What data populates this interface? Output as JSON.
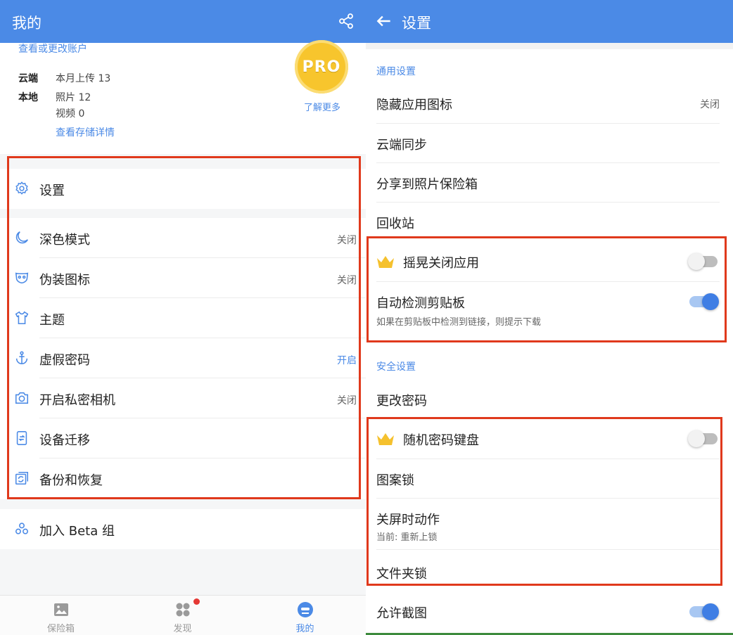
{
  "left": {
    "title": "我的",
    "account_link": "查看或更改账户",
    "cloud_label": "云端",
    "cloud_value": "本月上传 13",
    "local_label": "本地",
    "photos_value": "照片 12",
    "videos_value": "视频 0",
    "storage_link": "查看存储详情",
    "pro_badge": "PRO",
    "learn_more": "了解更多",
    "settings_label": "设置",
    "menu_items": [
      {
        "label": "深色模式",
        "status": "关闭",
        "icon": "moon-icon"
      },
      {
        "label": "伪装图标",
        "status": "关闭",
        "icon": "mask-icon"
      },
      {
        "label": "主题",
        "status": "",
        "icon": "shirt-icon"
      },
      {
        "label": "虚假密码",
        "status": "开启",
        "icon": "anchor-icon"
      },
      {
        "label": "开启私密相机",
        "status": "关闭",
        "icon": "camera-icon"
      },
      {
        "label": "设备迁移",
        "status": "",
        "icon": "phone-transfer-icon"
      },
      {
        "label": "备份和恢复",
        "status": "",
        "icon": "backup-icon"
      }
    ],
    "beta_label": "加入 Beta 组",
    "nav": [
      {
        "label": "保险箱",
        "icon": "gallery-icon"
      },
      {
        "label": "发现",
        "icon": "discover-icon"
      },
      {
        "label": "我的",
        "icon": "profile-icon"
      }
    ]
  },
  "right": {
    "title": "设置",
    "general_section": "通用设置",
    "general_items": [
      {
        "label": "隐藏应用图标",
        "status": "关闭"
      },
      {
        "label": "云端同步",
        "status": ""
      },
      {
        "label": "分享到照片保险箱",
        "status": ""
      },
      {
        "label": "回收站",
        "status": ""
      }
    ],
    "shake_close": {
      "label": "摇晃关闭应用",
      "enabled": false
    },
    "clipboard": {
      "label": "自动检测剪贴板",
      "description": "如果在剪贴板中检测到链接，则提示下载",
      "enabled": true
    },
    "security_section": "安全设置",
    "change_password": "更改密码",
    "random_keyboard": {
      "label": "随机密码键盘",
      "enabled": false
    },
    "pattern_lock": "图案锁",
    "screen_off_action": {
      "label": "关屏时动作",
      "current": "当前: 重新上锁"
    },
    "folder_lock": "文件夹锁",
    "allow_screenshot": {
      "label": "允许截图",
      "enabled": true
    }
  },
  "colors": {
    "accent": "#4b8ae6",
    "highlight_box": "#e0391c",
    "crown": "#f5c12e"
  }
}
